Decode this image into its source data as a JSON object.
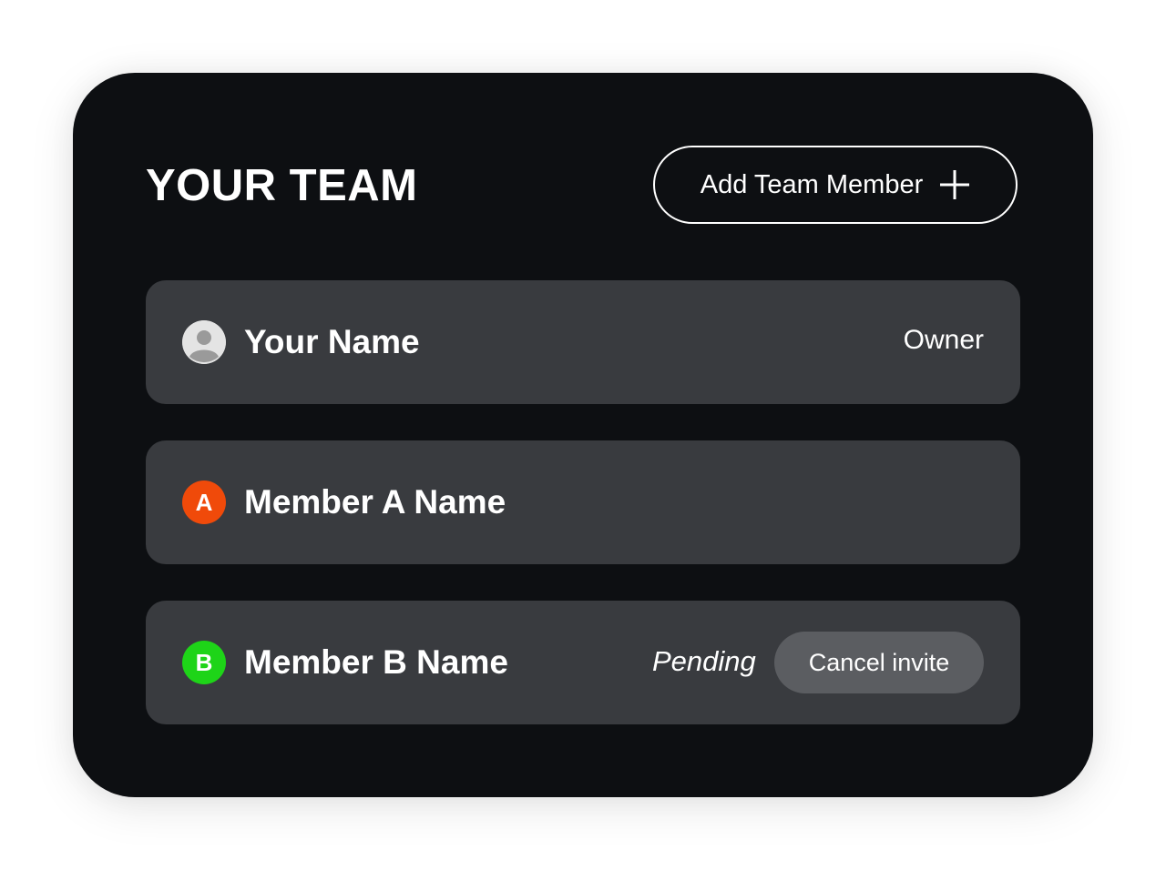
{
  "header": {
    "title": "YOUR TEAM",
    "add_button_label": "Add Team Member",
    "add_button_icon": "plus-icon"
  },
  "members": [
    {
      "name": "Your Name",
      "avatar_icon": "user-avatar-icon",
      "role": "Owner"
    },
    {
      "name": "Member A Name",
      "avatar_initial": "A",
      "avatar_color": "#f04a0a"
    },
    {
      "name": "Member B Name",
      "avatar_initial": "B",
      "avatar_color": "#1ed418",
      "status": "Pending",
      "action_label": "Cancel invite"
    }
  ],
  "colors": {
    "card_background": "#0d0f12",
    "row_background": "#393b3f",
    "cancel_button_background": "#5b5d61",
    "text": "#ffffff"
  }
}
